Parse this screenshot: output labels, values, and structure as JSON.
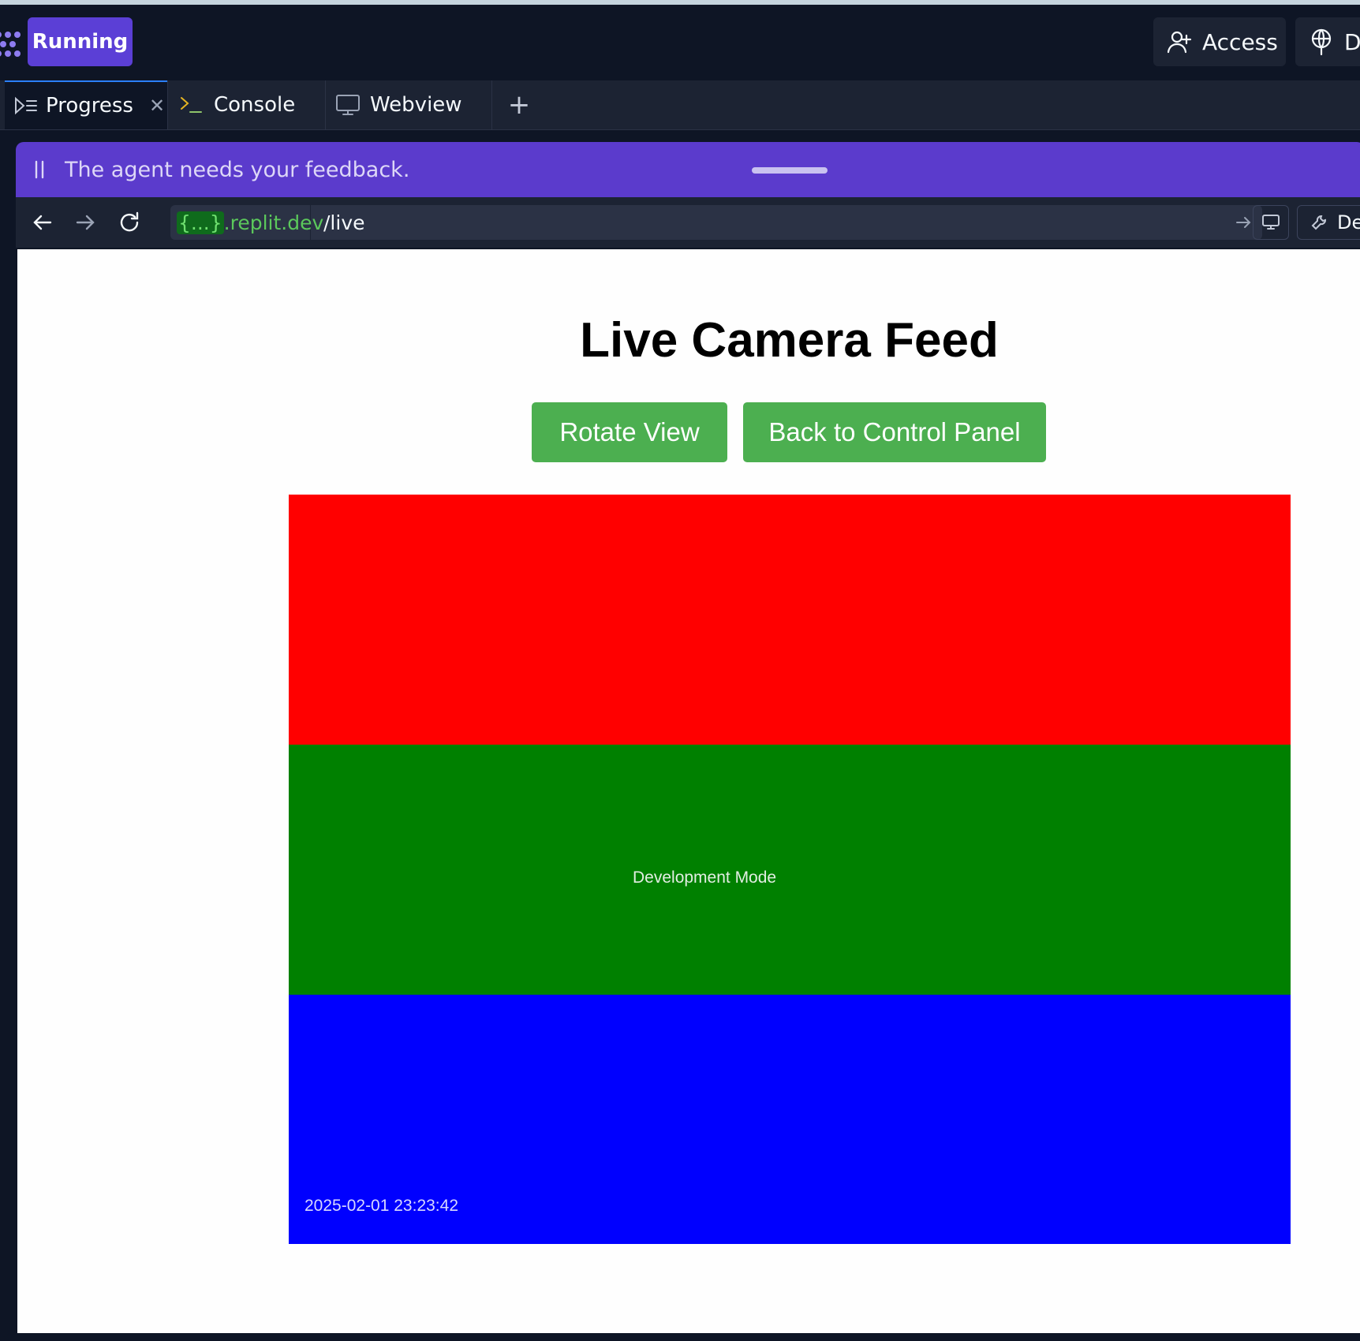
{
  "header": {
    "status_label": "Running",
    "access_label": "Access",
    "deploy_label": "D"
  },
  "tabs": [
    {
      "label": "Progress",
      "icon": "progress-icon",
      "active": true
    },
    {
      "label": "Console",
      "icon": "terminal-icon",
      "active": false
    },
    {
      "label": "Webview",
      "icon": "monitor-icon",
      "active": false
    }
  ],
  "feedback": {
    "message": "The agent needs your feedback."
  },
  "browser": {
    "domain_highlight": "{...}",
    "domain_suffix": ".replit.dev",
    "path": "/live",
    "devtools_label": "De"
  },
  "page": {
    "title": "Live Camera Feed",
    "rotate_label": "Rotate View",
    "back_label": "Back to Control Panel",
    "feed": {
      "mode_label": "Development Mode",
      "timestamp": "2025-02-01 23:23:42",
      "colors": [
        "#ff0000",
        "#008000",
        "#0000ff"
      ]
    }
  },
  "colors": {
    "accent": "#5b3fd6",
    "banner": "#5b3bcc",
    "button_green": "#4caf50"
  }
}
